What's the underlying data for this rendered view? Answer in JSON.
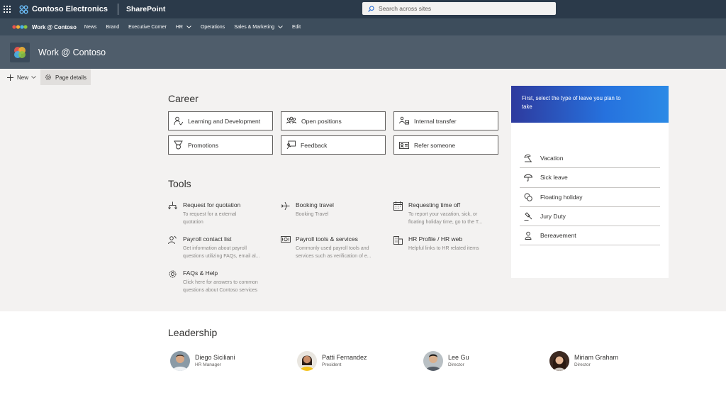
{
  "suite_bar": {
    "org_name": "Contoso Electronics",
    "app_name": "SharePoint",
    "search_placeholder": "Search across sites"
  },
  "hub_nav": {
    "title": "Work @ Contoso",
    "items": [
      {
        "label": "News",
        "has_menu": false
      },
      {
        "label": "Brand",
        "has_menu": false
      },
      {
        "label": "Executive Corner",
        "has_menu": false
      },
      {
        "label": "HR",
        "has_menu": true
      },
      {
        "label": "Operations",
        "has_menu": false
      },
      {
        "label": "Sales & Marketing",
        "has_menu": true
      },
      {
        "label": "Edit",
        "has_menu": false
      }
    ]
  },
  "site": {
    "title": "Work @ Contoso"
  },
  "command_bar": {
    "new_label": "New",
    "page_details_label": "Page details"
  },
  "career": {
    "heading": "Career",
    "buttons": [
      {
        "label": "Learning and Development",
        "icon": "learning-icon"
      },
      {
        "label": "Open positions",
        "icon": "people-icon"
      },
      {
        "label": "Internal transfer",
        "icon": "transfer-icon"
      },
      {
        "label": "Promotions",
        "icon": "ribbon-icon"
      },
      {
        "label": "Feedback",
        "icon": "feedback-icon"
      },
      {
        "label": "Refer someone",
        "icon": "contact-card-icon"
      }
    ]
  },
  "tools": {
    "heading": "Tools",
    "items": [
      {
        "title": "Request for quotation",
        "description": [
          "To request for a external",
          "quotation"
        ],
        "icon": "flow-icon"
      },
      {
        "title": "Booking travel",
        "description": [
          "Booking Travel"
        ],
        "icon": "airplane-icon"
      },
      {
        "title": "Requesting time off",
        "description": [
          "To report your vacation, sick, or",
          "floating holiday time, go to the T..."
        ],
        "icon": "calendar-icon"
      },
      {
        "title": "Payroll contact list",
        "description": [
          "Get information about payroll",
          "questions utilizing FAQs, email al..."
        ],
        "icon": "contacts-icon"
      },
      {
        "title": "Payroll tools & services",
        "description": [
          "Commonly used payroll tools and",
          "services such as verification of e..."
        ],
        "icon": "money-icon"
      },
      {
        "title": "HR Profile / HR web",
        "description": [
          "Helpful links to HR related items"
        ],
        "icon": "building-icon"
      },
      {
        "title": "FAQs & Help",
        "description": [
          "Click here for answers to common",
          "questions about Contoso services"
        ],
        "icon": "gear-icon"
      }
    ]
  },
  "leave": {
    "banner_text": "First, select the type of leave you plan to take",
    "items": [
      {
        "label": "Vacation",
        "icon": "beach-icon"
      },
      {
        "label": "Sick leave",
        "icon": "umbrella-icon"
      },
      {
        "label": "Floating holiday",
        "icon": "coins-icon"
      },
      {
        "label": "Jury Duty",
        "icon": "gavel-icon"
      },
      {
        "label": "Bereavement",
        "icon": "person-icon"
      }
    ]
  },
  "leadership": {
    "heading": "Leadership",
    "people": [
      {
        "name": "Diego Siciliani",
        "role": "HR Manager"
      },
      {
        "name": "Patti Fernandez",
        "role": "President"
      },
      {
        "name": "Lee Gu",
        "role": "Director"
      },
      {
        "name": "Miriam Graham",
        "role": "Director"
      }
    ]
  },
  "colors": {
    "suite_bar": "#2b3a4a",
    "hub_nav": "#3d4d5c",
    "site_header": "#4f5d6b",
    "banner_start": "#2e3a9e",
    "banner_end": "#2b8ae6"
  }
}
